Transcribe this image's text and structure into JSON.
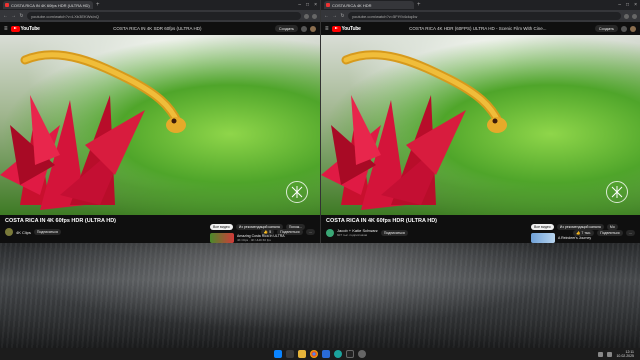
{
  "left_window": {
    "tab_title": "COSTA RICA IN 4K 60fps HDR (ULTRA HD)",
    "url": "youtube.com/watch?v=LXb3EKWsInQ",
    "logo_text": "YouTube",
    "mini_title": "COSTA RICA IN 4K SDR 60fps (ULTRA HD)",
    "create_label": "Создать",
    "video_title": "COSTA RICA IN 4K 60fps HDR (ULTRA HD)",
    "channel_name": "4K Clips",
    "channel_subs": "",
    "subscribe_label": "Подписаться",
    "like_count": "5",
    "share_label": "Поделиться",
    "chips": [
      "Все видео",
      "Из рекомендаций канала",
      "Похож..."
    ],
    "rec_title": "Amazing Costa Rica in ULTRA",
    "rec_sub": "4K Clips · 4K UHD 60 fps"
  },
  "right_window": {
    "tab_title": "COSTA RICA 4K HDR",
    "url": "youtube.com/watch?v=5FtYb4ckq4w",
    "logo_text": "YouTube",
    "mini_title": "COSTA RICA 4K HDR (60FPS) ULTRA HD - Scenic Film With Cine...",
    "create_label": "Создать",
    "video_title": "COSTA RICA IN 4K 60fps HDR (ULTRA HD)",
    "channel_name": "Jacob + Katie Schwarz",
    "channel_subs": "607 тыс. подписчиков",
    "subscribe_label": "Подписаться",
    "like_count": "7 тыс.",
    "share_label": "Поделиться",
    "chips": [
      "Все видео",
      "Из рекомендаций канала",
      "Мо"
    ],
    "rec_title": "A Reindeer's Journey",
    "rec_sub": ""
  },
  "taskbar": {
    "time": "12:11",
    "date": "10.02.2025"
  },
  "icons": [
    "windows-start-icon",
    "search-icon",
    "folder-icon",
    "chrome-icon",
    "store-icon",
    "edge-icon",
    "terminal-icon",
    "settings-icon"
  ],
  "colors": {
    "youtube_red": "#ff0000",
    "taskbar": "#1c1c1c",
    "browser_chrome": "#35363a"
  }
}
